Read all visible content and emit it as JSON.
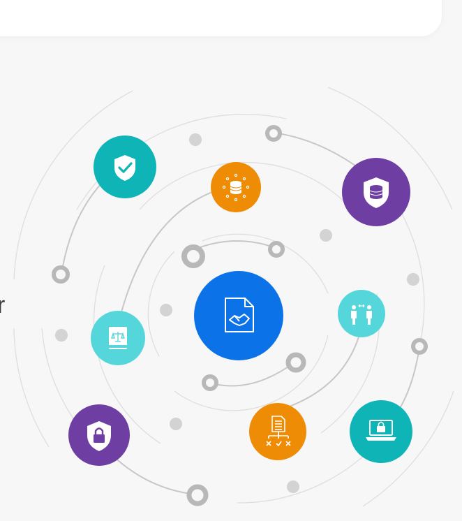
{
  "edge_text": "r",
  "colors": {
    "teal": "#0fb4b7",
    "orange": "#ef8c05",
    "purple": "#6f3ea3",
    "blue": "#0b72e7",
    "aqua": "#55d6db",
    "ring_gray": "#b8b8b8",
    "dot_gray": "#d3d3d3",
    "arc_gray": "#d9d9d9"
  },
  "nodes": [
    {
      "id": "document-agreement",
      "icon": "document-handshake-icon",
      "color": "blue"
    },
    {
      "id": "shield-check",
      "icon": "shield-check-icon",
      "color": "teal"
    },
    {
      "id": "data-network",
      "icon": "database-network-icon",
      "color": "orange"
    },
    {
      "id": "database-shield",
      "icon": "database-shield-icon",
      "color": "purple"
    },
    {
      "id": "law-book",
      "icon": "law-book-icon",
      "color": "aqua"
    },
    {
      "id": "people-exchange",
      "icon": "people-exchange-icon",
      "color": "aqua"
    },
    {
      "id": "lock-shield",
      "icon": "lock-shield-icon",
      "color": "purple"
    },
    {
      "id": "document-workflow",
      "icon": "document-workflow-icon",
      "color": "orange"
    },
    {
      "id": "laptop-lock",
      "icon": "laptop-lock-icon",
      "color": "teal"
    }
  ]
}
